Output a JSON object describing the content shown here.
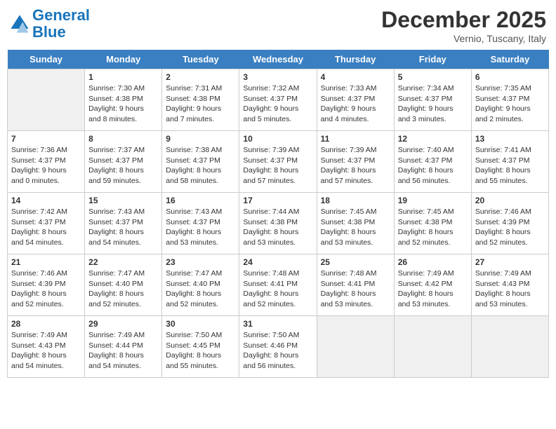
{
  "header": {
    "logo_line1": "General",
    "logo_line2": "Blue",
    "month": "December 2025",
    "location": "Vernio, Tuscany, Italy"
  },
  "weekdays": [
    "Sunday",
    "Monday",
    "Tuesday",
    "Wednesday",
    "Thursday",
    "Friday",
    "Saturday"
  ],
  "weeks": [
    [
      {
        "day": "",
        "info": "",
        "shaded": true
      },
      {
        "day": "1",
        "info": "Sunrise: 7:30 AM\nSunset: 4:38 PM\nDaylight: 9 hours\nand 8 minutes.",
        "shaded": false
      },
      {
        "day": "2",
        "info": "Sunrise: 7:31 AM\nSunset: 4:38 PM\nDaylight: 9 hours\nand 7 minutes.",
        "shaded": false
      },
      {
        "day": "3",
        "info": "Sunrise: 7:32 AM\nSunset: 4:37 PM\nDaylight: 9 hours\nand 5 minutes.",
        "shaded": false
      },
      {
        "day": "4",
        "info": "Sunrise: 7:33 AM\nSunset: 4:37 PM\nDaylight: 9 hours\nand 4 minutes.",
        "shaded": false
      },
      {
        "day": "5",
        "info": "Sunrise: 7:34 AM\nSunset: 4:37 PM\nDaylight: 9 hours\nand 3 minutes.",
        "shaded": false
      },
      {
        "day": "6",
        "info": "Sunrise: 7:35 AM\nSunset: 4:37 PM\nDaylight: 9 hours\nand 2 minutes.",
        "shaded": false
      }
    ],
    [
      {
        "day": "7",
        "info": "Sunrise: 7:36 AM\nSunset: 4:37 PM\nDaylight: 9 hours\nand 0 minutes.",
        "shaded": false
      },
      {
        "day": "8",
        "info": "Sunrise: 7:37 AM\nSunset: 4:37 PM\nDaylight: 8 hours\nand 59 minutes.",
        "shaded": false
      },
      {
        "day": "9",
        "info": "Sunrise: 7:38 AM\nSunset: 4:37 PM\nDaylight: 8 hours\nand 58 minutes.",
        "shaded": false
      },
      {
        "day": "10",
        "info": "Sunrise: 7:39 AM\nSunset: 4:37 PM\nDaylight: 8 hours\nand 57 minutes.",
        "shaded": false
      },
      {
        "day": "11",
        "info": "Sunrise: 7:39 AM\nSunset: 4:37 PM\nDaylight: 8 hours\nand 57 minutes.",
        "shaded": false
      },
      {
        "day": "12",
        "info": "Sunrise: 7:40 AM\nSunset: 4:37 PM\nDaylight: 8 hours\nand 56 minutes.",
        "shaded": false
      },
      {
        "day": "13",
        "info": "Sunrise: 7:41 AM\nSunset: 4:37 PM\nDaylight: 8 hours\nand 55 minutes.",
        "shaded": false
      }
    ],
    [
      {
        "day": "14",
        "info": "Sunrise: 7:42 AM\nSunset: 4:37 PM\nDaylight: 8 hours\nand 54 minutes.",
        "shaded": false
      },
      {
        "day": "15",
        "info": "Sunrise: 7:43 AM\nSunset: 4:37 PM\nDaylight: 8 hours\nand 54 minutes.",
        "shaded": false
      },
      {
        "day": "16",
        "info": "Sunrise: 7:43 AM\nSunset: 4:37 PM\nDaylight: 8 hours\nand 53 minutes.",
        "shaded": false
      },
      {
        "day": "17",
        "info": "Sunrise: 7:44 AM\nSunset: 4:38 PM\nDaylight: 8 hours\nand 53 minutes.",
        "shaded": false
      },
      {
        "day": "18",
        "info": "Sunrise: 7:45 AM\nSunset: 4:38 PM\nDaylight: 8 hours\nand 53 minutes.",
        "shaded": false
      },
      {
        "day": "19",
        "info": "Sunrise: 7:45 AM\nSunset: 4:38 PM\nDaylight: 8 hours\nand 52 minutes.",
        "shaded": false
      },
      {
        "day": "20",
        "info": "Sunrise: 7:46 AM\nSunset: 4:39 PM\nDaylight: 8 hours\nand 52 minutes.",
        "shaded": false
      }
    ],
    [
      {
        "day": "21",
        "info": "Sunrise: 7:46 AM\nSunset: 4:39 PM\nDaylight: 8 hours\nand 52 minutes.",
        "shaded": false
      },
      {
        "day": "22",
        "info": "Sunrise: 7:47 AM\nSunset: 4:40 PM\nDaylight: 8 hours\nand 52 minutes.",
        "shaded": false
      },
      {
        "day": "23",
        "info": "Sunrise: 7:47 AM\nSunset: 4:40 PM\nDaylight: 8 hours\nand 52 minutes.",
        "shaded": false
      },
      {
        "day": "24",
        "info": "Sunrise: 7:48 AM\nSunset: 4:41 PM\nDaylight: 8 hours\nand 52 minutes.",
        "shaded": false
      },
      {
        "day": "25",
        "info": "Sunrise: 7:48 AM\nSunset: 4:41 PM\nDaylight: 8 hours\nand 53 minutes.",
        "shaded": false
      },
      {
        "day": "26",
        "info": "Sunrise: 7:49 AM\nSunset: 4:42 PM\nDaylight: 8 hours\nand 53 minutes.",
        "shaded": false
      },
      {
        "day": "27",
        "info": "Sunrise: 7:49 AM\nSunset: 4:43 PM\nDaylight: 8 hours\nand 53 minutes.",
        "shaded": false
      }
    ],
    [
      {
        "day": "28",
        "info": "Sunrise: 7:49 AM\nSunset: 4:43 PM\nDaylight: 8 hours\nand 54 minutes.",
        "shaded": false
      },
      {
        "day": "29",
        "info": "Sunrise: 7:49 AM\nSunset: 4:44 PM\nDaylight: 8 hours\nand 54 minutes.",
        "shaded": false
      },
      {
        "day": "30",
        "info": "Sunrise: 7:50 AM\nSunset: 4:45 PM\nDaylight: 8 hours\nand 55 minutes.",
        "shaded": false
      },
      {
        "day": "31",
        "info": "Sunrise: 7:50 AM\nSunset: 4:46 PM\nDaylight: 8 hours\nand 56 minutes.",
        "shaded": false
      },
      {
        "day": "",
        "info": "",
        "shaded": true
      },
      {
        "day": "",
        "info": "",
        "shaded": true
      },
      {
        "day": "",
        "info": "",
        "shaded": true
      }
    ]
  ]
}
